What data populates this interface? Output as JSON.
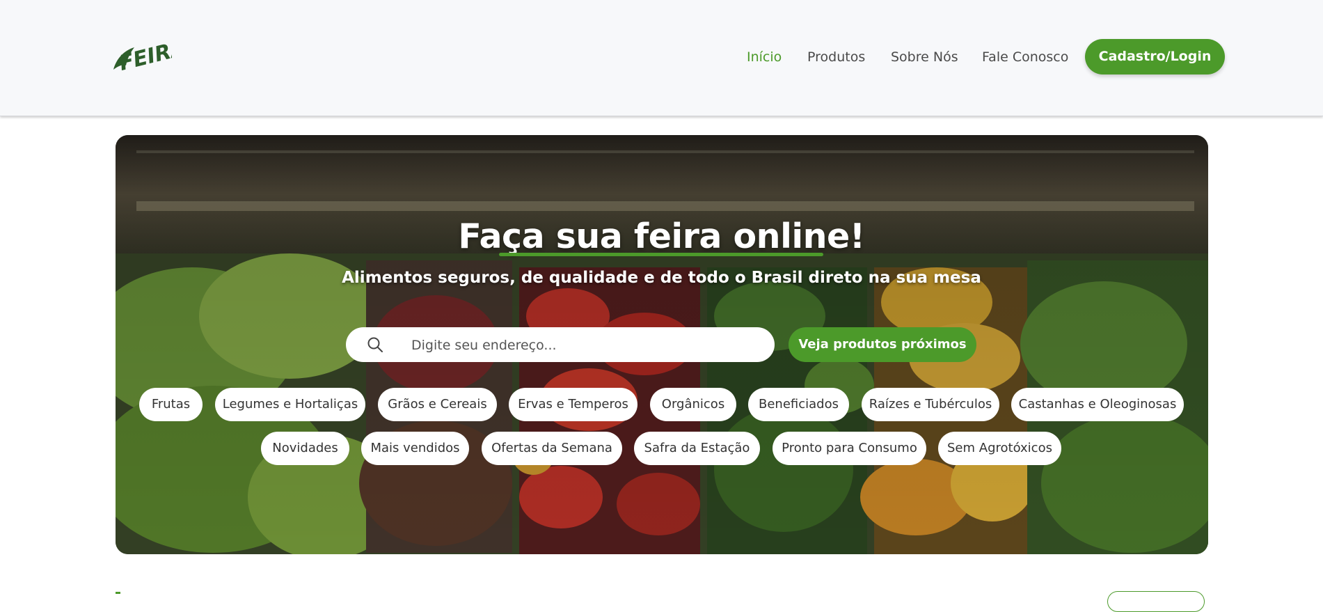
{
  "brand": {
    "logo_text": "FEIRA",
    "color": "#4c9a2a",
    "logo_color": "#2d5e2a"
  },
  "nav": {
    "items": [
      {
        "label": "Início",
        "active": true
      },
      {
        "label": "Produtos",
        "active": false
      },
      {
        "label": "Sobre Nós",
        "active": false
      },
      {
        "label": "Fale Conosco",
        "active": false
      }
    ],
    "login_label": "Cadastro/Login"
  },
  "hero": {
    "title": "Faça sua feira online!",
    "subtitle": "Alimentos seguros, de qualidade e de todo o Brasil direto na sua mesa",
    "search": {
      "placeholder": "Digite seu endereço...",
      "value": "",
      "icon": "search-icon"
    },
    "search_button": "Veja produtos próximos",
    "categories_row1": [
      "Frutas",
      "Legumes e Hortaliças",
      "Grãos e Cereais",
      "Ervas e Temperos",
      "Orgânicos",
      "Beneficiados",
      "Raízes e Tubérculos",
      "Castanhas e Oleoginosas"
    ],
    "categories_row2": [
      "Novidades",
      "Mais vendidos",
      "Ofertas da Semana",
      "Safra da Estação",
      "Pronto para Consumo",
      "Sem Agrotóxicos"
    ]
  }
}
